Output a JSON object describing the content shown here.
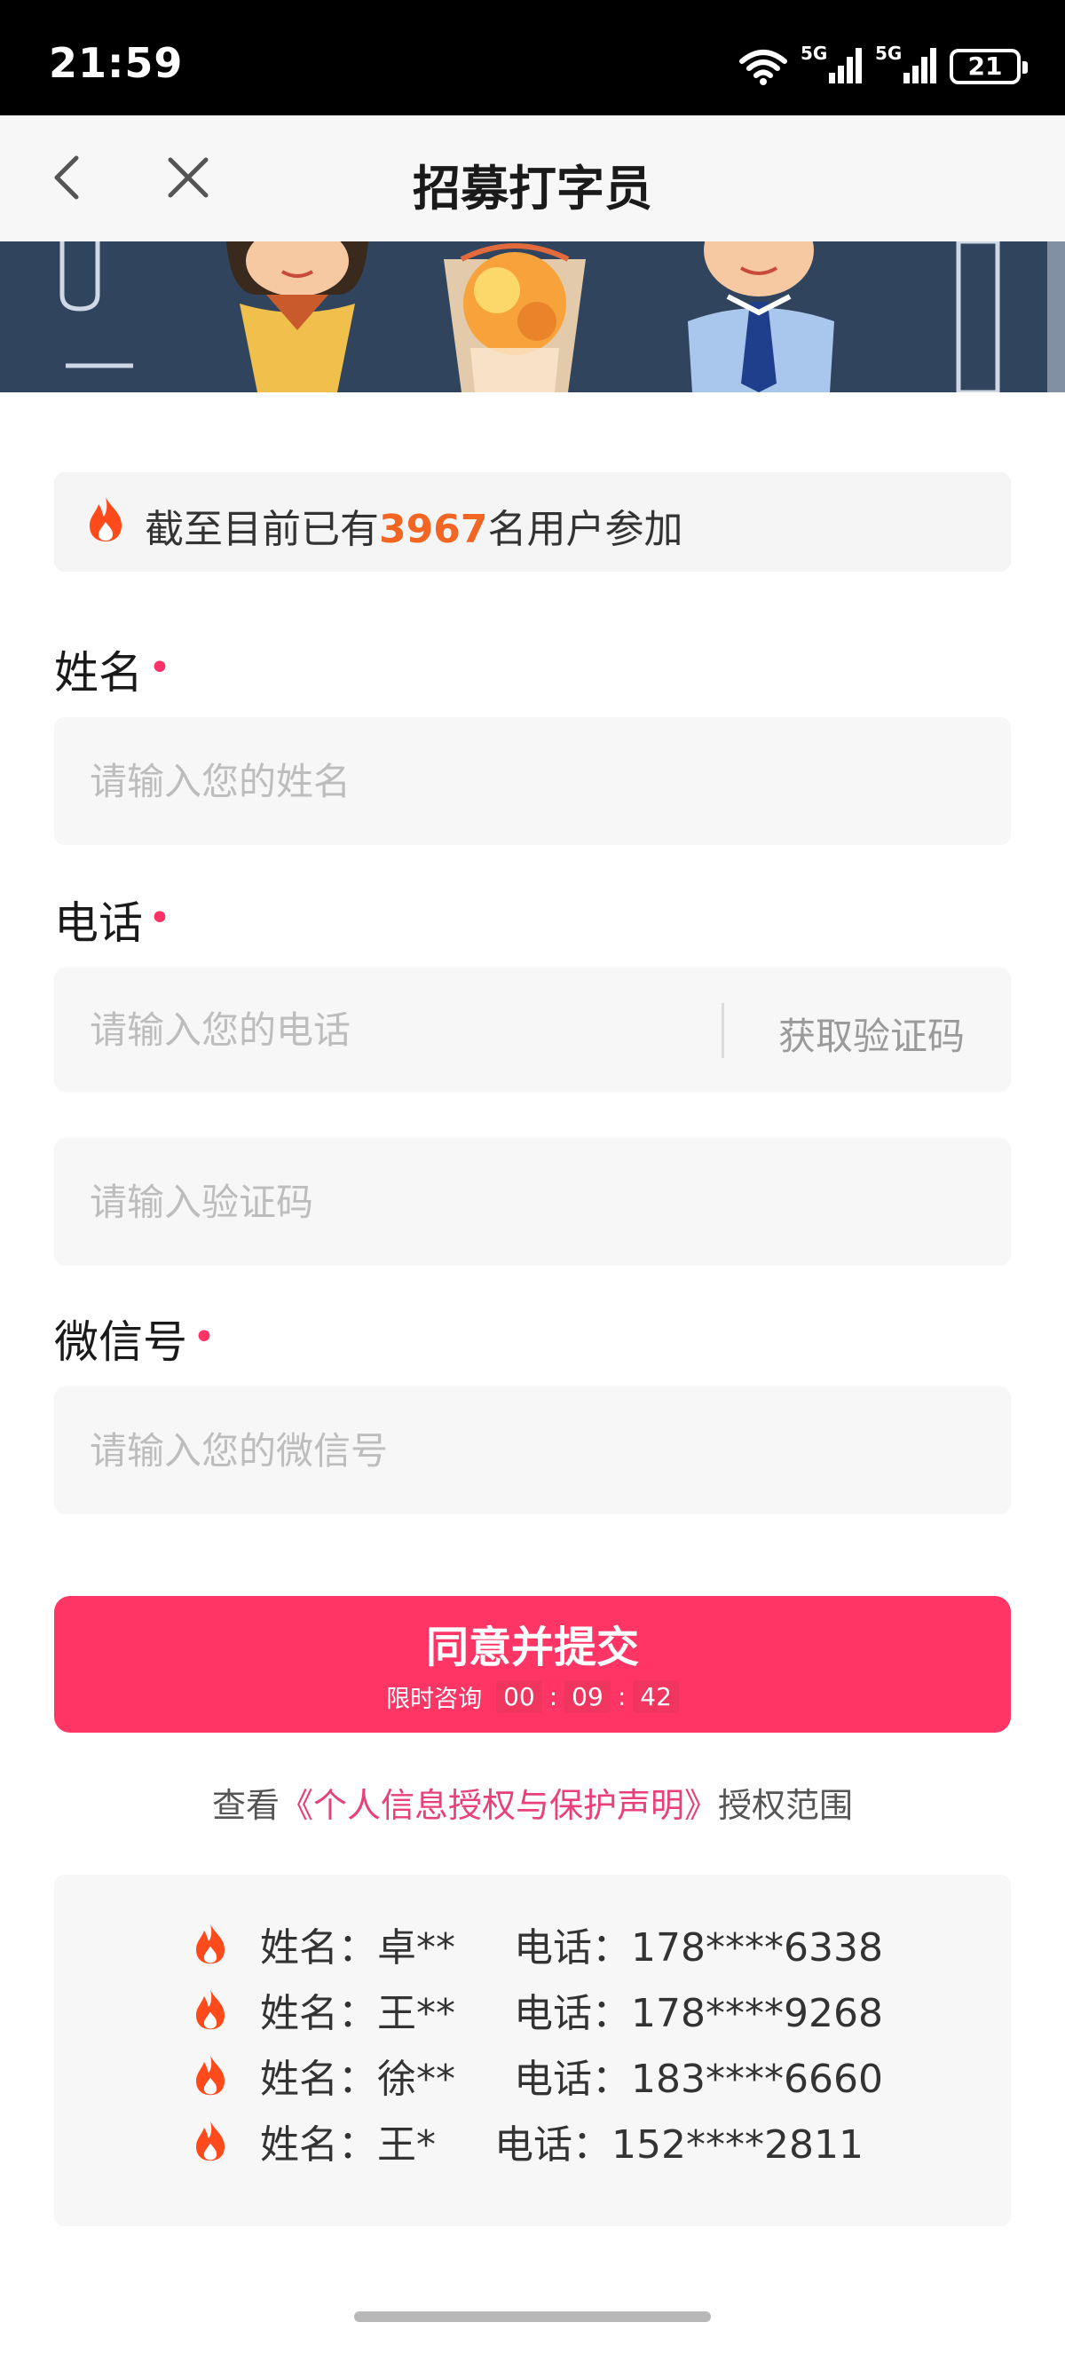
{
  "status_bar": {
    "time": "21:59",
    "battery": "21",
    "network_1": "5G",
    "network_2": "5G"
  },
  "nav": {
    "title": "招募打字员"
  },
  "banner": {
    "illustration": "cartoon-people-with-drink"
  },
  "count_box": {
    "prefix": "截至目前已有",
    "count": "3967",
    "suffix": "名用户参加",
    "icon": "fire-icon"
  },
  "form": {
    "name_label": "姓名",
    "name_placeholder": "请输入您的姓名",
    "phone_label": "电话",
    "phone_placeholder": "请输入您的电话",
    "get_code_label": "获取验证码",
    "code_placeholder": "请输入验证码",
    "wechat_label": "微信号",
    "wechat_placeholder": "请输入您的微信号",
    "required_mark": "•"
  },
  "submit": {
    "label": "同意并提交",
    "countdown_prefix": "限时咨询",
    "hh": "00",
    "mm": "09",
    "ss": "42",
    "sep": ":"
  },
  "agreement": {
    "prefix": "查看",
    "link": "《个人信息授权与保护声明》",
    "suffix": "授权范围"
  },
  "registrations": [
    {
      "name": "姓名：卓**",
      "phone": "电话：178****6338"
    },
    {
      "name": "姓名：王**",
      "phone": "电话：178****9268"
    },
    {
      "name": "姓名：徐**",
      "phone": "电话：183****6660"
    },
    {
      "name": "姓名：王*",
      "phone": "电话：152****2811"
    }
  ],
  "colors": {
    "accent": "#ff3566",
    "count_orange": "#f26522",
    "link_pink": "#e8407a",
    "fire_red": "#ff4a1c"
  }
}
